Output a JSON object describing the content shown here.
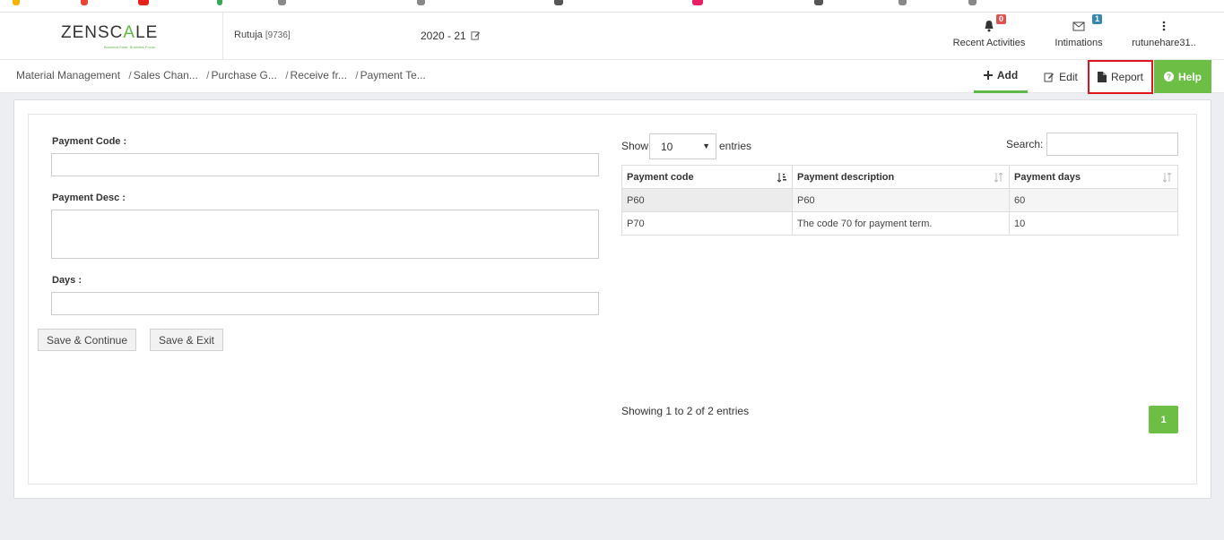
{
  "header": {
    "logo": "ZENSCALE",
    "logo_main": "ZENSC",
    "logo_accent": "A",
    "logo_end": "LE",
    "logo_tagline": "Business Ease. Business Focus.",
    "user_name": "Rutuja",
    "user_id": "[9736]",
    "fiscal_year": "2020 - 21",
    "nav": [
      {
        "label": "Recent Activities",
        "icon": "bell-icon",
        "badge": "0",
        "badge_color": "#d9534f"
      },
      {
        "label": "Intimations",
        "icon": "envelope-icon",
        "badge": "1",
        "badge_color": "#3a87ad"
      },
      {
        "label": "rutunehare31..",
        "icon": "kebab-menu-icon"
      }
    ]
  },
  "breadcrumb": {
    "items": [
      "Material Management",
      "Sales Chan...",
      "Purchase G...",
      "Receive fr...",
      "Payment Te..."
    ],
    "separator": "/"
  },
  "actions": {
    "add": "Add",
    "edit": "Edit",
    "report": "Report",
    "help": "Help"
  },
  "form": {
    "payment_code_label": "Payment Code :",
    "payment_code_value": "",
    "payment_desc_label": "Payment Desc :",
    "payment_desc_value": "",
    "days_label": "Days :",
    "days_value": "",
    "save_continue": "Save & Continue",
    "save_exit": "Save & Exit"
  },
  "table": {
    "show_label": "Show",
    "entries_label": "entries",
    "page_size": "10",
    "search_label": "Search:",
    "search_value": "",
    "columns": [
      "Payment code",
      "Payment description",
      "Payment days"
    ],
    "rows": [
      [
        "P60",
        "P60",
        "60"
      ],
      [
        "P70",
        "The code 70 for payment term.",
        "10"
      ]
    ],
    "info": "Showing 1 to 2 of 2 entries",
    "current_page": "1"
  },
  "colors": {
    "brand_green": "#6cbf44",
    "highlight_red": "#e0141e"
  }
}
